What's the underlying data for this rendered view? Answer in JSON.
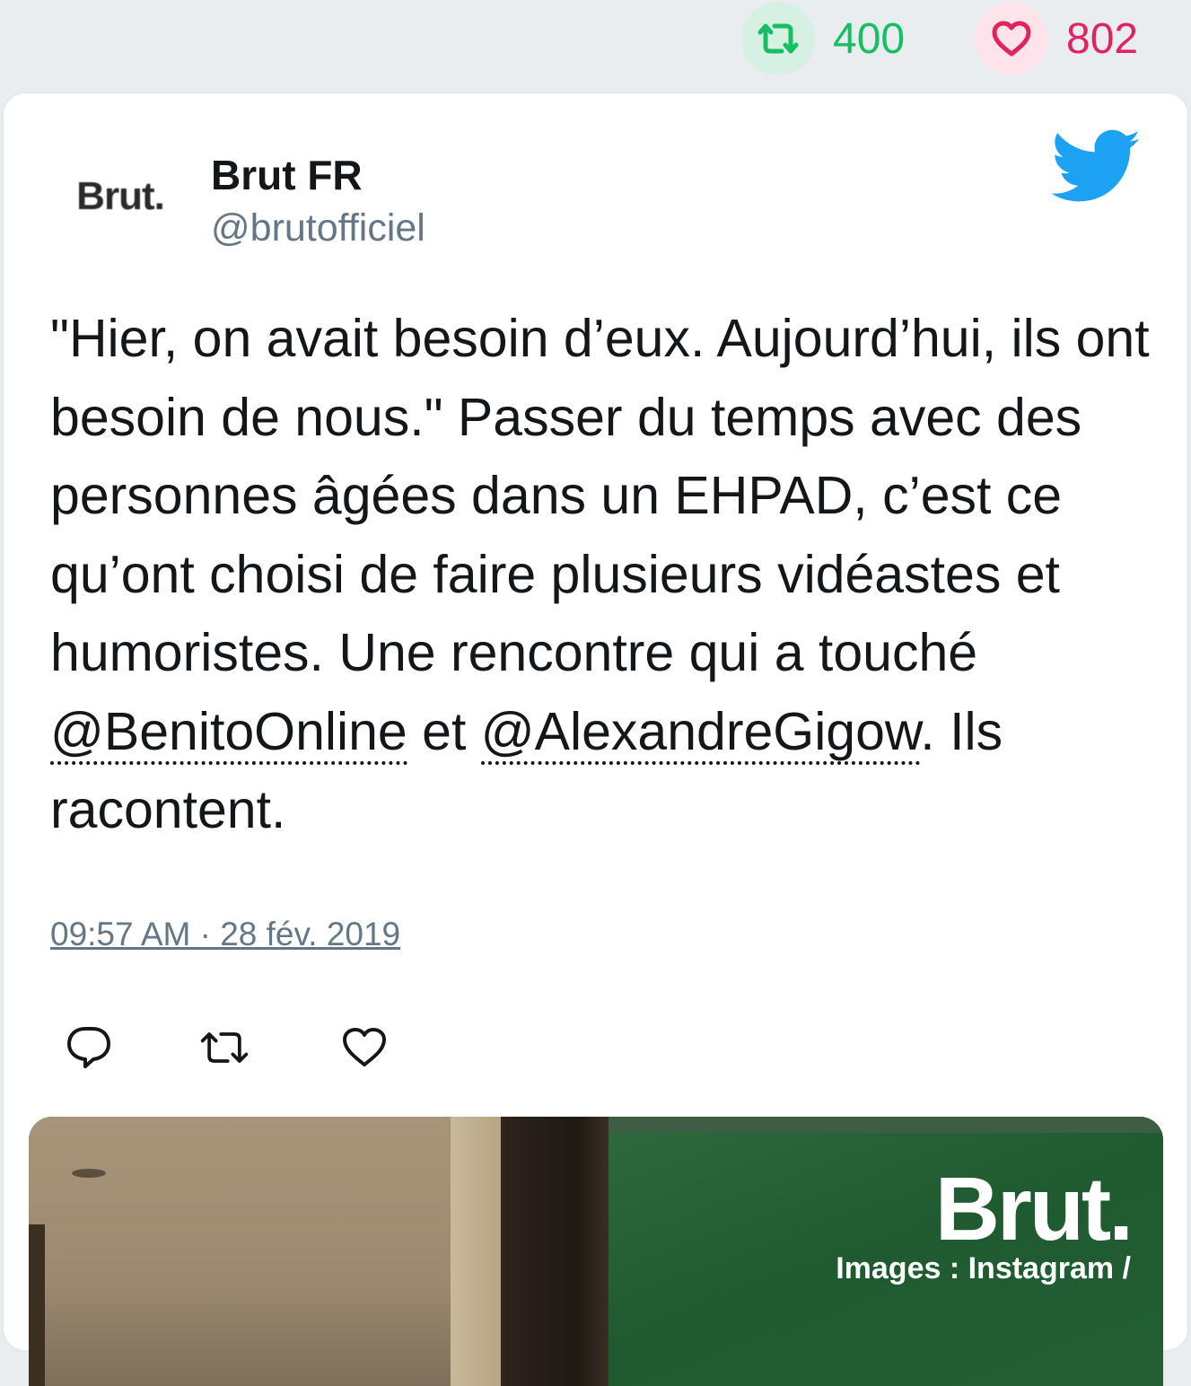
{
  "stats": {
    "retweets": "400",
    "likes": "802"
  },
  "author": {
    "avatar_text": "Brut.",
    "name": "Brut FR",
    "handle": "@brutofficiel"
  },
  "tweet": {
    "text_part1": "\"Hier, on avait besoin d’eux. Aujourd’hui, ils ont besoin de nous.\" Passer du temps avec des personnes âgées dans un EHPAD, c’est ce qu’ont choisi de faire plusieurs vidéastes et humoristes. Une rencontre qui a touché ",
    "mention1": "@BenitoOnline",
    "text_part2": " et ",
    "mention2": "@AlexandreGigow",
    "text_part3": ". Ils racontent.",
    "timestamp": "09:57 AM · 28 fév. 2019"
  },
  "media": {
    "brand": "Brut.",
    "credit": "Images : Instagram /"
  },
  "colors": {
    "retweet_green": "#17bf63",
    "like_red": "#e0245e",
    "twitter_blue": "#1da1f2",
    "secondary_text": "#657786"
  },
  "icons": {
    "top_retweet": "retweet-icon",
    "top_like": "heart-icon",
    "brand": "twitter-bird-icon",
    "action_reply": "reply-icon",
    "action_retweet": "retweet-icon",
    "action_like": "heart-icon"
  }
}
